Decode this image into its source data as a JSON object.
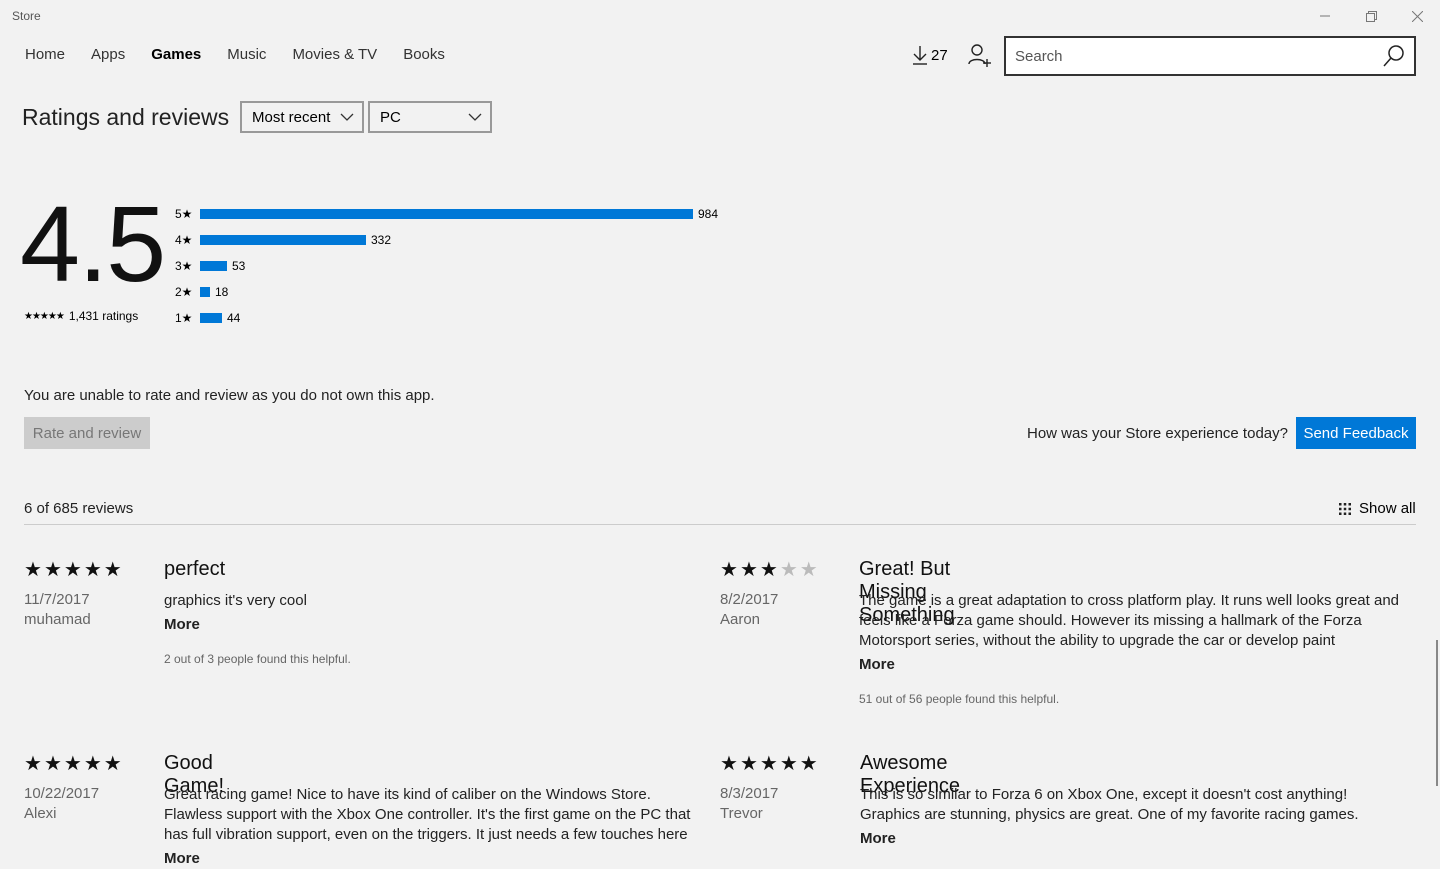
{
  "window": {
    "title": "Store"
  },
  "nav": {
    "items": [
      "Home",
      "Apps",
      "Games",
      "Music",
      "Movies & TV",
      "Books"
    ],
    "active": "Games"
  },
  "downloads": {
    "count": "27"
  },
  "search": {
    "placeholder": "Search"
  },
  "ratings": {
    "title": "Ratings and reviews",
    "sort": "Most recent",
    "platform": "PC",
    "average": "4.5",
    "total": "1,431 ratings",
    "stars_glyph": "★★★★★",
    "distribution": [
      {
        "label": "5★",
        "count": "984",
        "value": 984
      },
      {
        "label": "4★",
        "count": "332",
        "value": 332
      },
      {
        "label": "3★",
        "count": "53",
        "value": 53
      },
      {
        "label": "2★",
        "count": "18",
        "value": 18
      },
      {
        "label": "1★",
        "count": "44",
        "value": 44
      }
    ]
  },
  "notice": "You are unable to rate and review as you do not own this app.",
  "rate_button": "Rate and review",
  "feedback": {
    "question": "How was your Store experience today?",
    "button": "Send Feedback"
  },
  "reviews_header": {
    "count": "6 of 685 reviews",
    "show_all": "Show all"
  },
  "reviews": [
    {
      "stars": 5,
      "date": "11/7/2017",
      "author": "muhamad",
      "title": "perfect",
      "body": "graphics it's very cool",
      "more": "More",
      "helpful": "2 out of 3 people found this helpful."
    },
    {
      "stars": 3,
      "date": "8/2/2017",
      "author": "Aaron",
      "title": "Great! But Missing Something",
      "body": "The game is a great adaptation to cross platform play. It runs well looks great and feels like a Forza game should. However its missing a hallmark of the Forza Motorsport series, without the ability to upgrade the car or develop paint",
      "more": "More",
      "helpful": "51 out of 56 people found this helpful."
    },
    {
      "stars": 5,
      "date": "10/22/2017",
      "author": "Alexi",
      "title": "Good Game!",
      "body": "Great racing game! Nice to have its kind of caliber on the Windows Store. Flawless support with the Xbox One controller. It's the first game on the PC that has full vibration support, even on the triggers. It just needs a few touches here",
      "more": "More",
      "helpful": ""
    },
    {
      "stars": 5,
      "date": "8/3/2017",
      "author": "Trevor",
      "title": "Awesome Experience",
      "body": "This is so similar to Forza 6 on Xbox One, except it doesn't cost anything! Graphics are stunning, physics are great. One of my favorite racing games.",
      "more": "More",
      "helpful": ""
    }
  ],
  "colors": {
    "accent": "#0078d7",
    "background": "#f2f2f2"
  }
}
